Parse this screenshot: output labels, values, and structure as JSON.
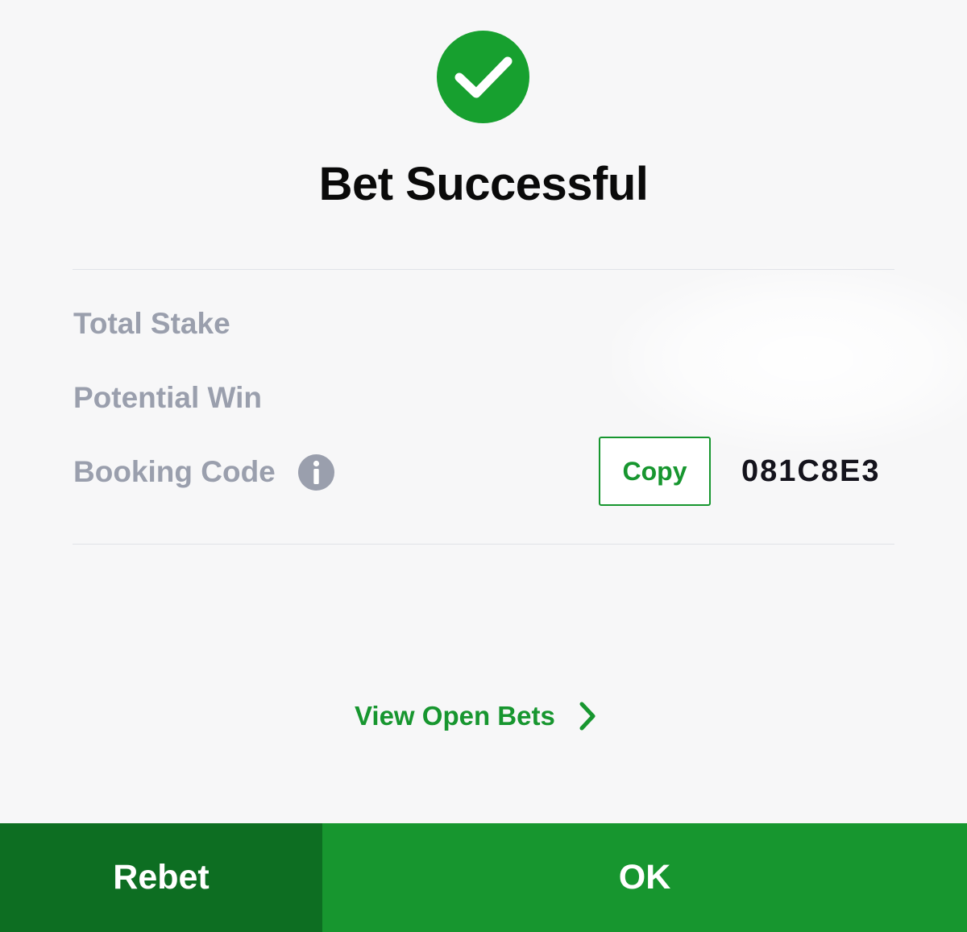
{
  "header": {
    "title": "Bet Successful"
  },
  "details": {
    "total_stake_label": "Total Stake",
    "potential_win_label": "Potential Win",
    "booking_code_label": "Booking Code",
    "copy_label": "Copy",
    "booking_code_value": "081C8E3"
  },
  "links": {
    "view_open_bets": "View Open Bets"
  },
  "footer": {
    "rebet_label": "Rebet",
    "ok_label": "OK"
  },
  "icons": {
    "success": "check-circle-icon",
    "info": "info-icon",
    "chevron": "chevron-right-icon"
  },
  "colors": {
    "brand_green": "#17962f",
    "dark_green": "#0d6e22",
    "label_gray": "#9a9fad"
  }
}
